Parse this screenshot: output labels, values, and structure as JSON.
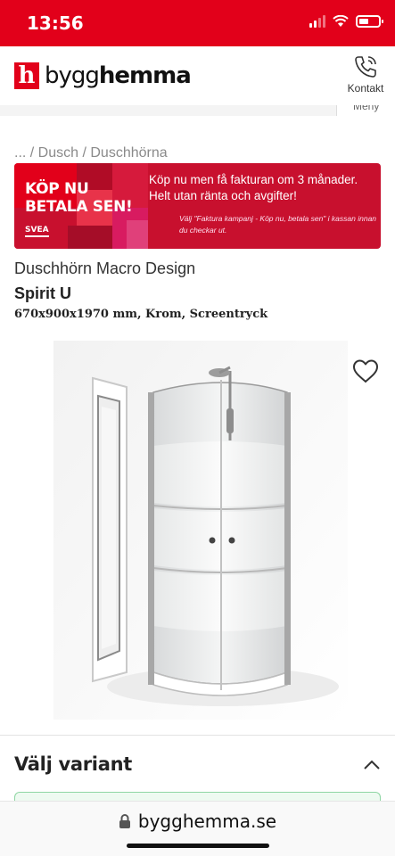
{
  "status_bar": {
    "time": "13:56"
  },
  "header": {
    "logo_mark": "h",
    "logo_prefix": "bygg",
    "logo_suffix": "hemma",
    "contact_label": "Kontakt",
    "menu_label": "Meny"
  },
  "breadcrumb": "... / Dusch / Duschhörna",
  "promo": {
    "title_line1": "KÖP NU",
    "title_line2": "BETALA SEN!",
    "brand": "SVEA",
    "heading": "Köp nu men få fakturan om 3 månader. Helt utan ränta och avgifter!",
    "note": "Välj \"Faktura kampanj - Köp nu, betala sen\" i kassan innan du checkar ut.",
    "colors": {
      "primary": "#c8102e",
      "accent": "#e2001a",
      "dark": "#a50d28",
      "pink": "#d81b60"
    }
  },
  "product": {
    "brand_line": "Duschhörn Macro Design",
    "name": "Spirit U",
    "spec": "670x900x1970 mm, Krom, Screentryck",
    "favorite_icon": "heart-outline-icon"
  },
  "variant": {
    "title": "Välj variant",
    "expanded": true
  },
  "browser": {
    "url": "bygghemma.se"
  },
  "colors": {
    "brand_red": "#e2001a",
    "variant_border": "#8fd6a4"
  }
}
